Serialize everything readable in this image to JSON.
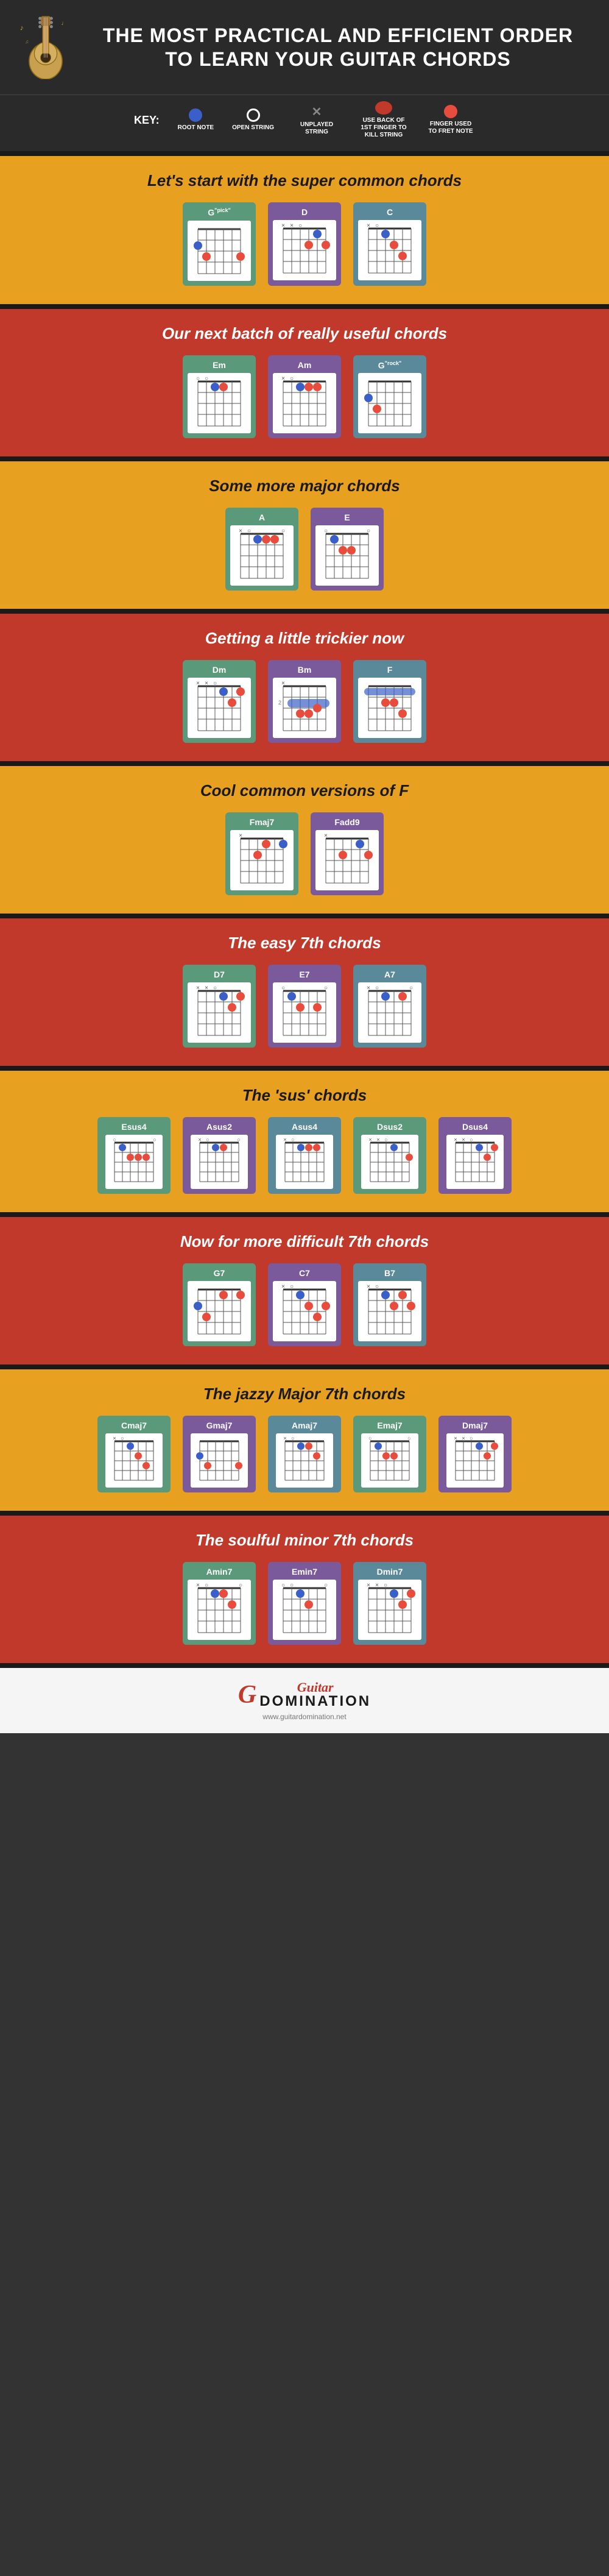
{
  "header": {
    "title": "THE MOST PRACTICAL AND EFFICIENT ORDER TO LEARN YOUR GUITAR CHORDS"
  },
  "key": {
    "label": "KEY:",
    "items": [
      {
        "id": "root-note",
        "label": "ROOT NOTE"
      },
      {
        "id": "open-string",
        "label": "OPEN STRING"
      },
      {
        "id": "unplayed-string",
        "label": "UNPLAYED STRING"
      },
      {
        "id": "use-back-1st-finger",
        "label": "USE BACK OF 1ST FINGER TO KILL STRING"
      },
      {
        "id": "finger-used-to-fret-note",
        "label": "FINGER USED TO FRET NOTE"
      }
    ]
  },
  "sections": [
    {
      "id": "super-common",
      "style": "yellow",
      "title": "Let's start with the super common chords",
      "chords": [
        "G\"pick\"",
        "D",
        "C"
      ]
    },
    {
      "id": "really-useful",
      "style": "red",
      "title": "Our next batch of really useful chords",
      "chords": [
        "Em",
        "Am",
        "G\"rock\""
      ]
    },
    {
      "id": "major-chords",
      "style": "yellow",
      "title": "Some more major chords",
      "chords": [
        "A",
        "E"
      ]
    },
    {
      "id": "trickier",
      "style": "red",
      "title": "Getting a little trickier now",
      "chords": [
        "Dm",
        "Bm",
        "F"
      ]
    },
    {
      "id": "cool-f",
      "style": "yellow",
      "title": "Cool common versions of F",
      "chords": [
        "Fmaj7",
        "Fadd9"
      ]
    },
    {
      "id": "easy-7th",
      "style": "red",
      "title": "The easy 7th chords",
      "chords": [
        "D7",
        "E7",
        "A7"
      ]
    },
    {
      "id": "sus-chords",
      "style": "yellow",
      "title": "The 'sus' chords",
      "chords": [
        "Esus4",
        "Asus2",
        "Asus4",
        "Dsus2",
        "Dsus4"
      ]
    },
    {
      "id": "difficult-7th",
      "style": "red",
      "title": "Now for more difficult 7th chords",
      "chords": [
        "G7",
        "C7",
        "B7"
      ]
    },
    {
      "id": "jazzy-major7",
      "style": "yellow",
      "title": "The jazzy Major 7th chords",
      "chords": [
        "Cmaj7",
        "Gmaj7",
        "Amaj7",
        "Emaj7",
        "Dmaj7"
      ]
    },
    {
      "id": "soulful-minor7",
      "style": "red",
      "title": "The soulful minor 7th chords",
      "chords": [
        "Amin7",
        "Emin7",
        "Dmin7"
      ]
    }
  ],
  "footer": {
    "logo_script": "Guitar",
    "logo_main": "Domination",
    "url": "www.guitardomination.net"
  }
}
